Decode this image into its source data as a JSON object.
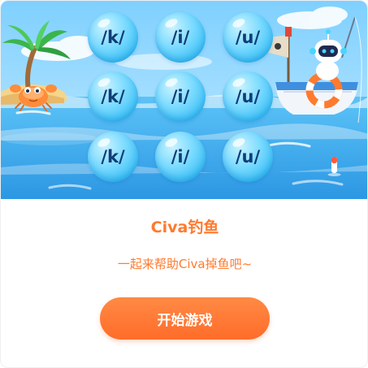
{
  "game": {
    "title": "Civa钓鱼",
    "subtitle": "一起来帮助Civa掉鱼吧~",
    "start_label": "开始游戏"
  },
  "bubbles": {
    "r1c1": "/k/",
    "r1c2": "/i/",
    "r1c3": "/u/",
    "r2c1": "/k/",
    "r2c2": "/i/",
    "r2c3": "/u/",
    "r3c1": "/k/",
    "r3c2": "/i/",
    "r3c3": "/u/"
  },
  "colors": {
    "accent": "#ff7a2e",
    "button": "#ff6c2a",
    "sky": "#8fd8ff",
    "sea": "#3aa9f0",
    "bubble_text": "#0f3d78"
  },
  "icons": {
    "palm": "palm-tree-icon",
    "crab": "crab-icon",
    "robot": "robot-fisher-icon",
    "boat": "boat-icon",
    "flag": "flag-icon",
    "lifebuoy": "lifebuoy-icon",
    "float": "fishing-float-icon"
  }
}
